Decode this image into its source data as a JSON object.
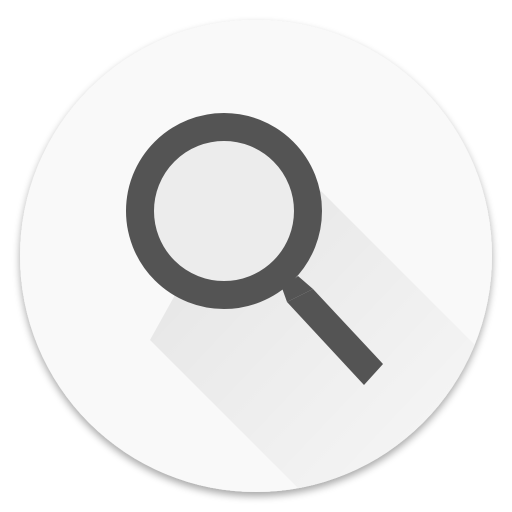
{
  "icon": {
    "name": "search-icon",
    "background_color": "#f9f9f9",
    "lens_fill_color": "#ececec",
    "glyph_color": "#545454",
    "shadow_color": "#e6e6e6"
  }
}
